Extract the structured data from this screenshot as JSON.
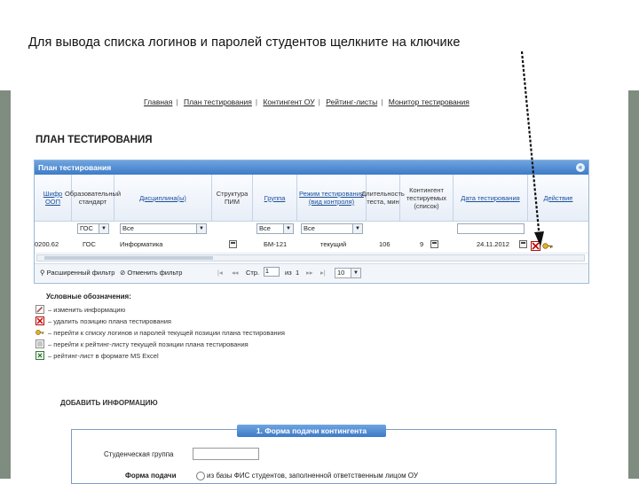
{
  "caption": "Для вывода списка логинов и паролей студентов щелкните на ключике",
  "nav": {
    "items": [
      "Главная",
      "План тестирования",
      "Контингент ОУ",
      "Рейтинг-листы",
      "Монитор тестирования"
    ]
  },
  "page_title": "ПЛАН ТЕСТИРОВАНИЯ",
  "grid": {
    "title": "План тестирования",
    "collapse_symbol": "«",
    "columns": [
      "Шифр ООП",
      "Образовательный стандарт",
      "Дисциплина(ы)",
      "Структура ПИМ",
      "Группа",
      "Режим тестирования (вид контроля)",
      "Длительность теста, мин",
      "Контингент тестируемых (список)",
      "Дата тестирования",
      "Действие"
    ],
    "filters": {
      "standard": "ГОС",
      "discipline": "Все",
      "group": "Все",
      "mode": "Все"
    },
    "row": {
      "code": "0200.62",
      "standard": "ГОС",
      "discipline": "Информатика",
      "group": "БМ-121",
      "mode": "текущий",
      "duration": "106",
      "count": "9",
      "date": "24.11.2012"
    },
    "pager": {
      "ext_filter": "Расширенный фильтр",
      "cancel_filter": "Отменить фильтр",
      "page_label": "Стр.",
      "page_value": "1",
      "of_label": "из",
      "of_value": "1",
      "per_page": "10"
    }
  },
  "legend": {
    "header": "Условные обозначения:",
    "items": [
      "– изменить информацию",
      "– удалить позицию плана тестирования",
      "– перейти к списку логинов и паролей текущей позиции плана тестирования",
      "– перейти к рейтинг-листу текущей позиции плана тестирования",
      "– рейтинг-лист в формате MS Excel"
    ]
  },
  "add_info": "ДОБАВИТЬ ИНФОРМАЦИЮ",
  "form": {
    "tab_title": "1. Форма подачи контингента",
    "group_label": "Студенческая группа",
    "submit_label": "Форма подачи",
    "radio_label": "из базы ФИС студентов, заполненной ответственным лицом ОУ"
  },
  "colors": {
    "slide_bg": "#7f8c80",
    "grid_header": "#3d7bc8",
    "link": "#1a4f9c"
  }
}
